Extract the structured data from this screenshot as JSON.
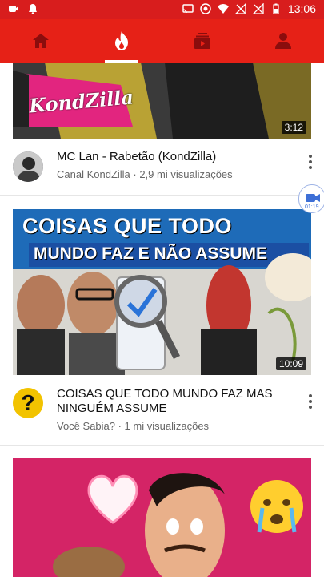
{
  "status_bar": {
    "time": "13:06",
    "icons": [
      "camera-icon",
      "notification-bell-icon",
      "cast-icon",
      "record-icon",
      "wifi-icon",
      "no-signal-icon",
      "no-signal-icon",
      "battery-icon"
    ]
  },
  "nav_tabs": [
    {
      "name": "home",
      "icon": "home-icon"
    },
    {
      "name": "trending",
      "icon": "flame-icon",
      "active": true
    },
    {
      "name": "subscriptions",
      "icon": "subscriptions-icon"
    },
    {
      "name": "account",
      "icon": "account-icon"
    }
  ],
  "videos": [
    {
      "title": "MC Lan - Rabetão (KondZilla)",
      "channel_line": "Canal KondZilla · 2,9 mi visualizações",
      "duration": "3:12",
      "thumb_logo": "KondZilla"
    },
    {
      "title": "COISAS QUE TODO MUNDO FAZ MAS NINGUÉM ASSUME",
      "channel_line": "Você Sabia? · 1 mi visualizações",
      "duration": "10:09",
      "thumb_text_1": "COISAS QUE TODO",
      "thumb_text_2": "MUNDO FAZ E NÃO ASSUME",
      "avatar_glyph": "?"
    },
    {
      "title": "",
      "channel_line": "",
      "duration": ""
    }
  ],
  "floating_button": {
    "label": "01:19"
  },
  "colors": {
    "status_bar": "#d81d1d",
    "app_bar": "#e62117",
    "accent": "#ffffff"
  }
}
